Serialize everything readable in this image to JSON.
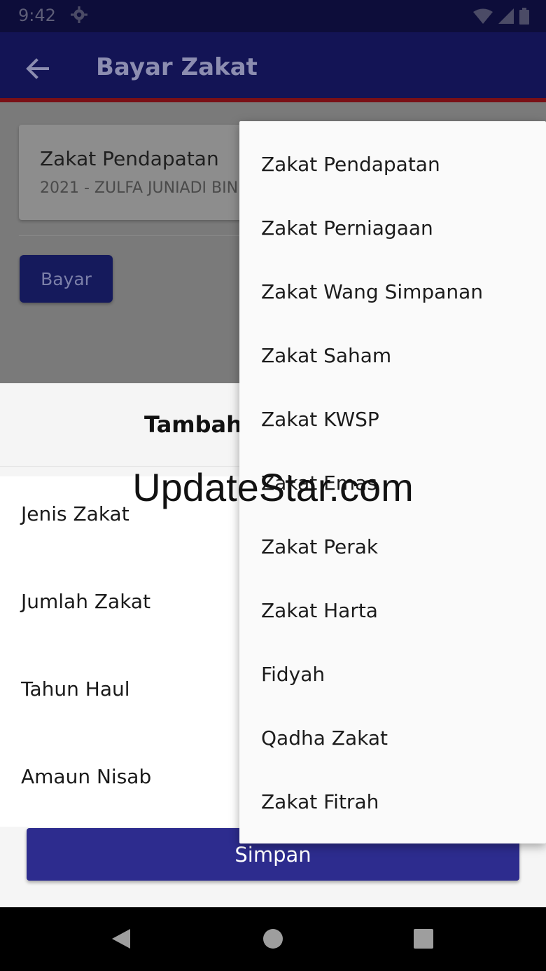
{
  "status_bar": {
    "time": "9:42",
    "icons": [
      "settings-icon",
      "wifi-icon",
      "signal-icon",
      "battery-icon"
    ]
  },
  "app_bar": {
    "title": "Bayar Zakat",
    "back_icon": "arrow-back-icon"
  },
  "card": {
    "title": "Zakat Pendapatan",
    "subtitle": "2021 - ZULFA JUNIADI BIN"
  },
  "pay_button": {
    "label": "Bayar"
  },
  "sheet": {
    "title": "Tambah",
    "fields": [
      {
        "label": "Jenis Zakat"
      },
      {
        "label": "Jumlah Zakat"
      },
      {
        "label": "Tahun Haul"
      },
      {
        "label": "Amaun Nisab"
      }
    ],
    "save_label": "Simpan"
  },
  "dropdown": {
    "options": [
      "Zakat Pendapatan",
      "Zakat Perniagaan",
      "Zakat Wang Simpanan",
      "Zakat Saham",
      "Zakat KWSP",
      "Zakat Emas",
      "Zakat Perak",
      "Zakat Harta",
      "Fidyah",
      "Qadha Zakat",
      "Zakat Fitrah"
    ]
  },
  "watermark": "UpdateStar.com",
  "colors": {
    "primary": "#2d2c8e",
    "appbar": "#131455",
    "accent_line": "#c41a24"
  },
  "nav_bar": {
    "icons": [
      "back-triangle-icon",
      "home-circle-icon",
      "recents-square-icon"
    ]
  }
}
